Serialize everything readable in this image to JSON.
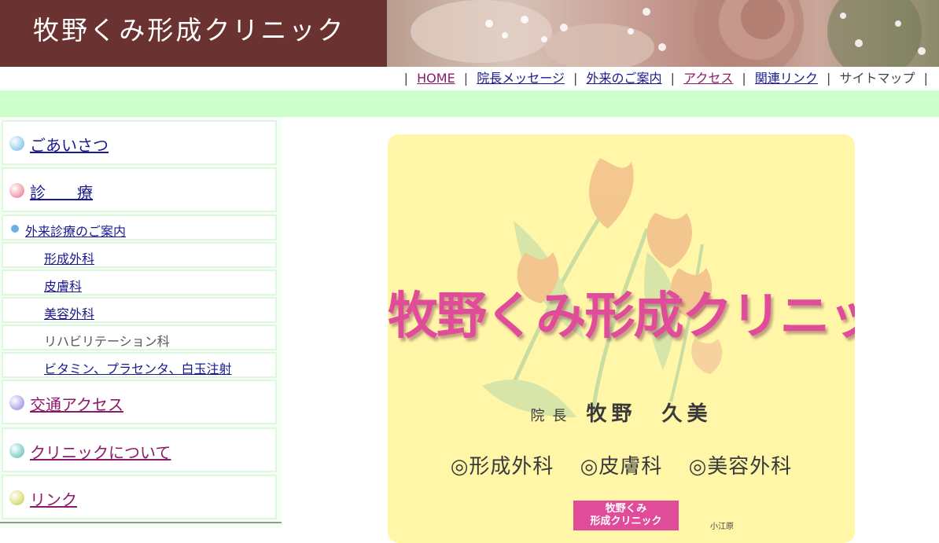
{
  "header": {
    "site_title": "牧野くみ形成クリニック"
  },
  "topnav": {
    "items": [
      {
        "label": "HOME",
        "link": true
      },
      {
        "label": "院長メッセージ",
        "link": true
      },
      {
        "label": "外来のご案内",
        "link": true
      },
      {
        "label": "アクセス",
        "link": true
      },
      {
        "label": "関連リンク",
        "link": true
      },
      {
        "label": "サイトマップ",
        "link": false
      }
    ]
  },
  "sidebar": {
    "items": [
      {
        "label": "ごあいさつ",
        "type": "main",
        "ball_color": "#9fd4f2"
      },
      {
        "label": "診　　療",
        "type": "main",
        "ball_color": "#f5a3b3"
      },
      {
        "label": "外来診療のご案内",
        "type": "sub1"
      },
      {
        "label": "形成外科",
        "type": "sub2"
      },
      {
        "label": "皮膚科",
        "type": "sub2"
      },
      {
        "label": "美容外科",
        "type": "sub2"
      },
      {
        "label": "リハビリテーション科",
        "type": "sub2"
      },
      {
        "label": "ビタミン、プラセンタ、白玉注射",
        "type": "sub2"
      },
      {
        "label": "交通アクセス",
        "type": "main",
        "ball_color": "#b8b0ee"
      },
      {
        "label": "クリニックについて",
        "type": "main",
        "ball_color": "#8fd6d0"
      },
      {
        "label": "リンク",
        "type": "main",
        "ball_color": "#e0e08a"
      }
    ]
  },
  "poster": {
    "title": "牧野くみ形成クリニック",
    "director_role": "院長",
    "director_name": "牧野　久美",
    "departments": [
      "◎形成外科",
      "◎皮膚科",
      "◎美容外科"
    ],
    "badge_line1": "牧野くみ",
    "badge_line2": "形成クリニック",
    "map_label": "小江原"
  },
  "colors": {
    "header_bg": "#6a3230",
    "green_band": "#ccffcc",
    "poster_bg": "#fff6a8",
    "poster_title": "#e04c9a",
    "link": "#1a1a8c",
    "visited_link": "#8c1a6a"
  }
}
